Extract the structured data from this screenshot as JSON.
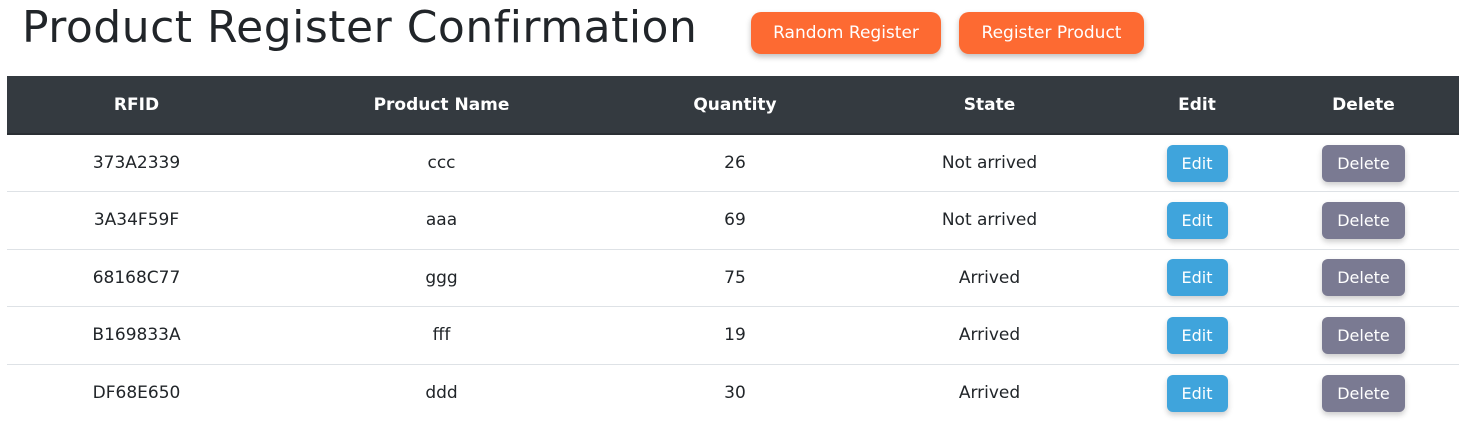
{
  "header": {
    "title": "Product Register Confirmation",
    "random_label": "Random Register",
    "register_label": "Register Product"
  },
  "table": {
    "columns": [
      "RFID",
      "Product Name",
      "Quantity",
      "State",
      "Edit",
      "Delete"
    ],
    "rows": [
      {
        "rfid": "373A2339",
        "name": "ccc",
        "quantity": "26",
        "state": "Not arrived",
        "edit": "Edit",
        "delete": "Delete"
      },
      {
        "rfid": "3A34F59F",
        "name": "aaa",
        "quantity": "69",
        "state": "Not arrived",
        "edit": "Edit",
        "delete": "Delete"
      },
      {
        "rfid": "68168C77",
        "name": "ggg",
        "quantity": "75",
        "state": "Arrived",
        "edit": "Edit",
        "delete": "Delete"
      },
      {
        "rfid": "B169833A",
        "name": "fff",
        "quantity": "19",
        "state": "Arrived",
        "edit": "Edit",
        "delete": "Delete"
      },
      {
        "rfid": "DF68E650",
        "name": "ddd",
        "quantity": "30",
        "state": "Arrived",
        "edit": "Edit",
        "delete": "Delete"
      }
    ]
  },
  "colors": {
    "accent": "#fd6a32",
    "header_bg": "#343a40",
    "edit_button": "#3fa4dc",
    "delete_button": "#7a7a92"
  }
}
